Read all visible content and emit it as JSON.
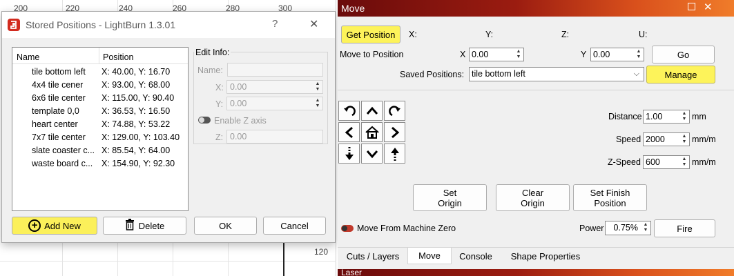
{
  "canvas": {
    "ruler_top": [
      "200",
      "220",
      "240",
      "260",
      "280",
      "300"
    ],
    "ruler_side": "120"
  },
  "dialog": {
    "title": "Stored Positions - LightBurn 1.3.01",
    "help": "?",
    "close": "✕",
    "columns": [
      "Name",
      "Position"
    ],
    "rows": [
      {
        "name": "tile bottom left",
        "position": "X: 40.00, Y: 16.70"
      },
      {
        "name": "4x4 tile cener",
        "position": "X: 93.00, Y: 68.00"
      },
      {
        "name": "6x6 tile center",
        "position": "X: 115.00, Y: 90.40"
      },
      {
        "name": "template 0,0",
        "position": "X: 36.53, Y: 16.50"
      },
      {
        "name": "heart center",
        "position": "X: 74.88, Y: 53.22"
      },
      {
        "name": "7x7 tile center",
        "position": "X: 129.00, Y: 103.40"
      },
      {
        "name": "slate coaster c...",
        "position": "X: 85.54, Y: 64.00"
      },
      {
        "name": "waste board c...",
        "position": "X: 154.90, Y: 92.30"
      }
    ],
    "edit_info": {
      "label": "Edit Info:",
      "name_label": "Name:",
      "x_label": "X:",
      "x_value": "0.00",
      "y_label": "Y:",
      "y_value": "0.00",
      "enable_z": "Enable Z axis",
      "z_label": "Z:",
      "z_value": "0.00"
    },
    "buttons": {
      "add_new": "Add New",
      "delete": "Delete",
      "ok": "OK",
      "cancel": "Cancel"
    }
  },
  "move": {
    "title": "Move",
    "get_position": "Get Position",
    "coord_labels": [
      "X:",
      "Y:",
      "Z:",
      "U:"
    ],
    "move_to_position": "Move to Position",
    "x_label": "X",
    "x_value": "0.00",
    "y_label": "Y",
    "y_value": "0.00",
    "go": "Go",
    "saved_positions_label": "Saved Positions:",
    "saved_positions_value": "tile bottom left",
    "manage": "Manage",
    "distance_label": "Distance",
    "distance_value": "1.00",
    "distance_unit": "mm",
    "speed_label": "Speed",
    "speed_value": "2000",
    "speed_unit": "mm/m",
    "zspeed_label": "Z-Speed",
    "zspeed_value": "600",
    "zspeed_unit": "mm/m",
    "set_origin": [
      "Set",
      "Origin"
    ],
    "clear_origin": [
      "Clear",
      "Origin"
    ],
    "set_finish": [
      "Set Finish",
      "Position"
    ],
    "move_from_zero": "Move From Machine Zero",
    "power_label": "Power",
    "power_value": "0.75%",
    "fire": "Fire",
    "tabs": [
      "Cuts / Layers",
      "Move",
      "Console",
      "Shape Properties"
    ],
    "next_panel_title": "Laser"
  },
  "colors": {
    "highlight": "#fbf05a",
    "title_gradient_start": "#6a0b0b",
    "title_gradient_end": "#f07c2a",
    "toggle_red": "#c0392b"
  }
}
